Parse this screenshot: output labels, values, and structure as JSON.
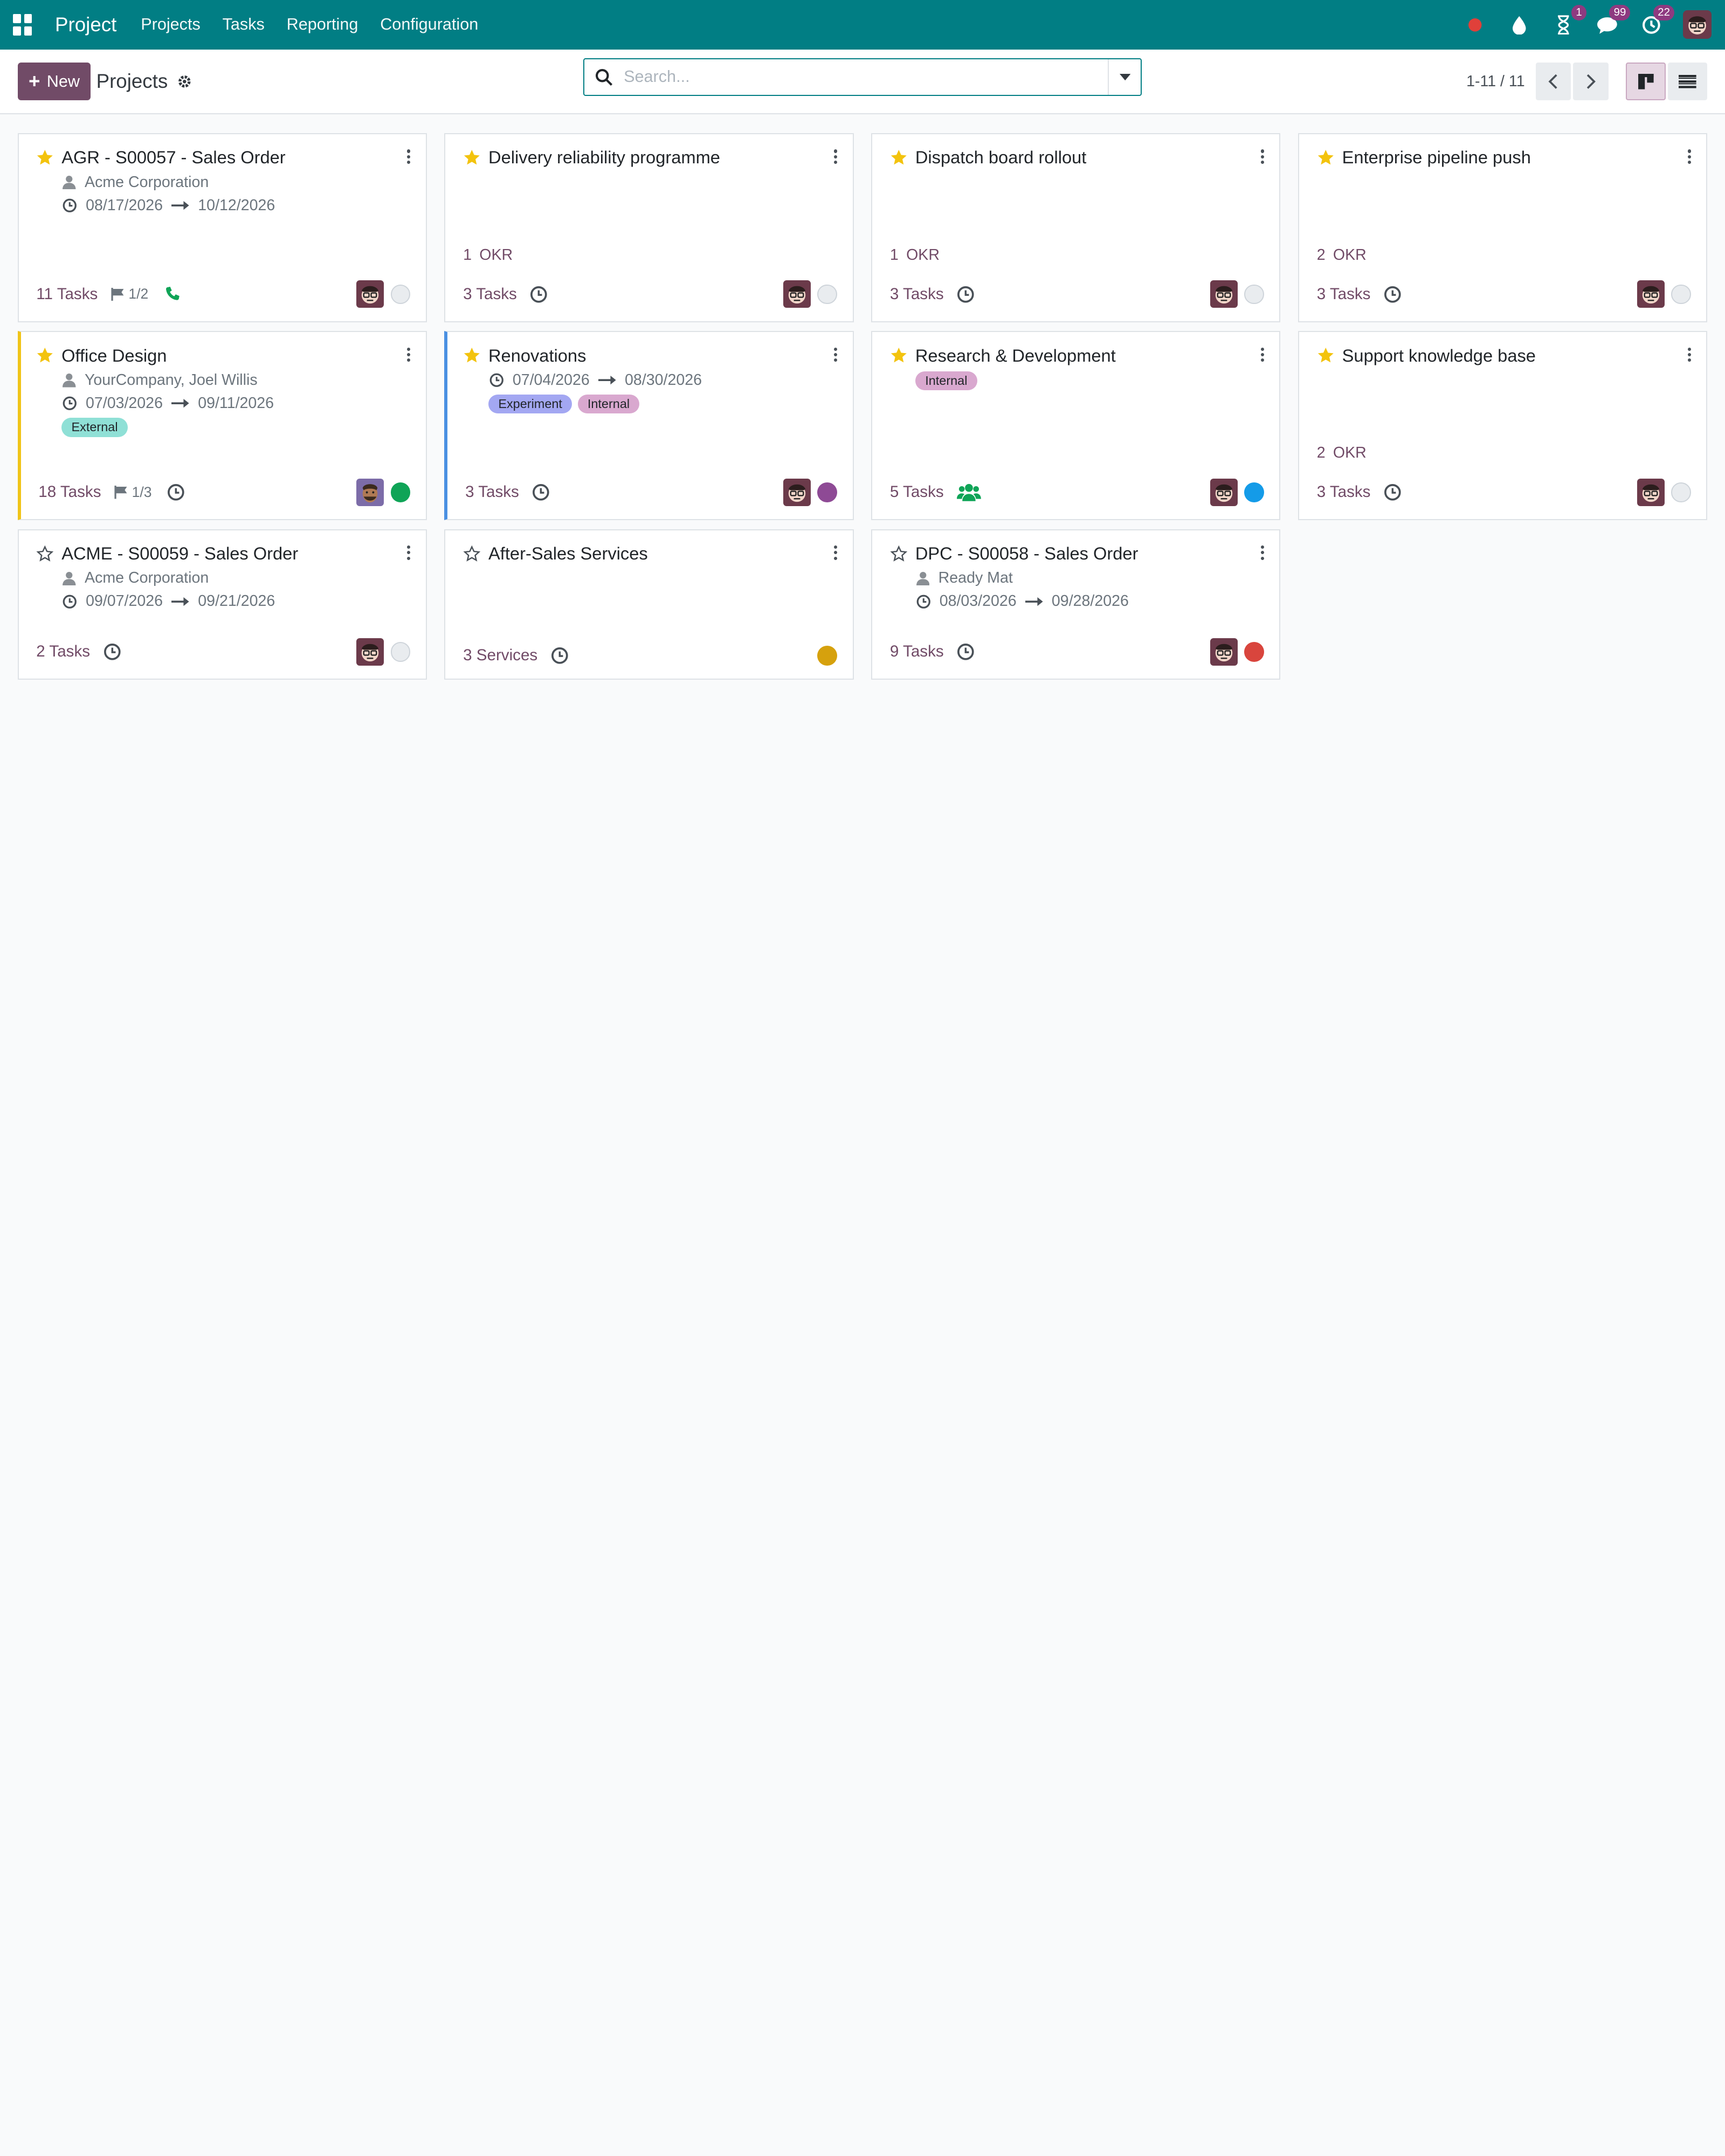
{
  "navbar": {
    "app_name": "Project",
    "menu": [
      "Projects",
      "Tasks",
      "Reporting",
      "Configuration"
    ],
    "activity_badge": "1",
    "messages_badge": "99",
    "clock_badge": "22"
  },
  "control_panel": {
    "new_label": "New",
    "title": "Projects",
    "search_placeholder": "Search...",
    "pager": "1-11 / 11"
  },
  "colors": {
    "brand": "#017e84",
    "primary": "#714b67",
    "star": "#f3c30d",
    "status_green": "#0fa457",
    "status_purple": "#8e4a95",
    "status_blue": "#149be8",
    "status_yellow": "#d6a10d",
    "status_red": "#d9453d"
  },
  "cards": [
    {
      "title": "AGR - S00057 - Sales Order",
      "customer": "Acme Corporation",
      "date_start": "08/17/2026",
      "date_end": "10/12/2026",
      "count": "11",
      "count_label": "Tasks",
      "milestones": "1/2",
      "activity_icon": "phone-icon",
      "status": "grey"
    },
    {
      "title": "Delivery reliability programme",
      "okr_count": "1",
      "okr_label": "OKR",
      "count": "3",
      "count_label": "Tasks",
      "activity_icon": "clock-icon",
      "status": "grey"
    },
    {
      "title": "Dispatch board rollout",
      "okr_count": "1",
      "okr_label": "OKR",
      "count": "3",
      "count_label": "Tasks",
      "activity_icon": "clock-icon",
      "status": "grey"
    },
    {
      "title": "Enterprise pipeline push",
      "okr_count": "2",
      "okr_label": "OKR",
      "count": "3",
      "count_label": "Tasks",
      "activity_icon": "clock-icon",
      "status": "grey"
    },
    {
      "title": "Office Design",
      "customer": "YourCompany, Joel Willis",
      "date_start": "07/03/2026",
      "date_end": "09/11/2026",
      "tags": [
        "External"
      ],
      "count": "18",
      "count_label": "Tasks",
      "milestones": "1/3",
      "activity_icon": "clock-icon",
      "status": "green"
    },
    {
      "title": "Renovations",
      "date_start": "07/04/2026",
      "date_end": "08/30/2026",
      "tags": [
        "Experiment",
        "Internal"
      ],
      "count": "3",
      "count_label": "Tasks",
      "activity_icon": "clock-icon",
      "status": "purple"
    },
    {
      "title": "Research & Development",
      "tags": [
        "Internal"
      ],
      "count": "5",
      "count_label": "Tasks",
      "activity_icon": "users-icon",
      "status": "blue"
    },
    {
      "title": "Support knowledge base",
      "okr_count": "2",
      "okr_label": "OKR",
      "count": "3",
      "count_label": "Tasks",
      "activity_icon": "clock-icon",
      "status": "grey"
    },
    {
      "title": "ACME - S00059 - Sales Order",
      "customer": "Acme Corporation",
      "date_start": "09/07/2026",
      "date_end": "09/21/2026",
      "count": "2",
      "count_label": "Tasks",
      "activity_icon": "clock-icon",
      "status": "grey"
    },
    {
      "title": "After-Sales Services",
      "count": "3",
      "count_label": "Services",
      "activity_icon": "clock-icon",
      "status": "yellow"
    },
    {
      "title": "DPC - S00058 - Sales Order",
      "customer": "Ready Mat",
      "date_start": "08/03/2026",
      "date_end": "09/28/2026",
      "count": "9",
      "count_label": "Tasks",
      "activity_icon": "clock-icon",
      "status": "red"
    }
  ]
}
